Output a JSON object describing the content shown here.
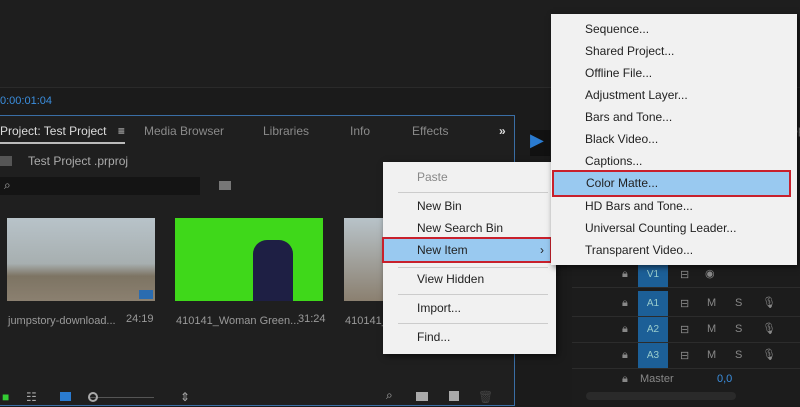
{
  "timecode": "0:00:01:04",
  "tabs": [
    "Project: Test Project",
    "Media Browser",
    "Libraries",
    "Info",
    "Effects"
  ],
  "tab_menu_icon": "≡",
  "overflow": "»",
  "project_file": "Test Project .prproj",
  "clips": [
    {
      "name": "jumpstory-download...",
      "duration": "24:19"
    },
    {
      "name": "410141_Woman Green...",
      "duration": "31:24"
    },
    {
      "name": "410141_",
      "duration": ""
    }
  ],
  "context_menu": [
    "Paste",
    "New Bin",
    "New Search Bin",
    "New Item",
    "View Hidden",
    "Import...",
    "Find..."
  ],
  "submenu": [
    "Sequence...",
    "Shared Project...",
    "Offline File...",
    "Adjustment Layer...",
    "Bars and Tone...",
    "Black Video...",
    "Captions...",
    "Color Matte...",
    "HD Bars and Tone...",
    "Universal Counting Leader...",
    "Transparent Video..."
  ],
  "tracks": [
    {
      "label": "V1"
    },
    {
      "label": "A1"
    },
    {
      "label": "A2"
    },
    {
      "label": "A3"
    }
  ],
  "mute": "M",
  "solo": "S",
  "master": {
    "label": "Master",
    "value": "0,0"
  },
  "right_tab_partial": "Sp",
  "colors": {
    "accent": "#3b8ede",
    "highlight": "#99c9f0",
    "outline": "#c8202c"
  }
}
